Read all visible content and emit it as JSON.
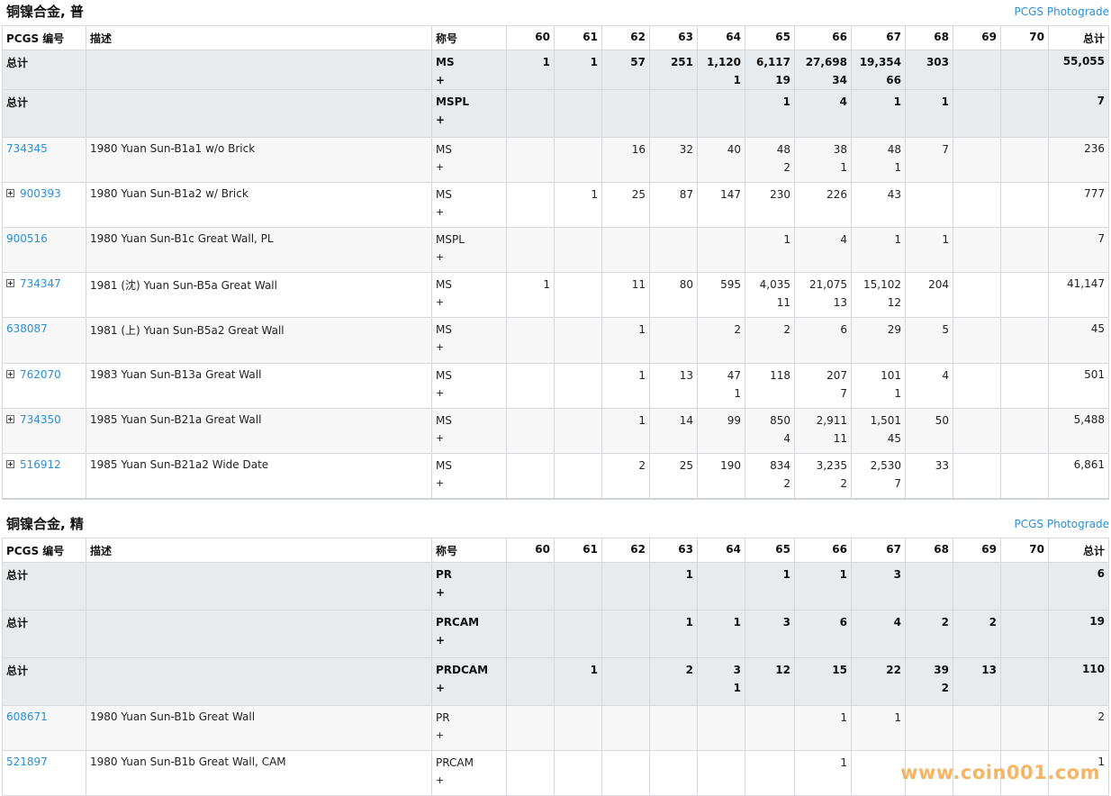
{
  "sections": [
    {
      "title": "铜镍合金, 普",
      "photograde": "PCGS Photograde",
      "headers": [
        "PCGS 编号",
        "描述",
        "称号",
        "60",
        "61",
        "62",
        "63",
        "64",
        "65",
        "66",
        "67",
        "68",
        "69",
        "70",
        "总计"
      ],
      "rows": [
        {
          "type": "total",
          "code": "总计",
          "desc": "",
          "desig": "MS",
          "plus": "+",
          "grades": [
            [
              "1",
              ""
            ],
            [
              "1",
              ""
            ],
            [
              "57",
              ""
            ],
            [
              "251",
              ""
            ],
            [
              "1,120",
              "1"
            ],
            [
              "6,117",
              "19"
            ],
            [
              "27,698",
              "34"
            ],
            [
              "19,354",
              "66"
            ],
            [
              "303",
              ""
            ],
            [
              "",
              ""
            ],
            [
              "",
              ""
            ]
          ],
          "total": "55,055"
        },
        {
          "type": "total",
          "code": "总计",
          "desc": "",
          "desig": "MSPL",
          "plus": "+",
          "grades": [
            [
              "",
              ""
            ],
            [
              "",
              ""
            ],
            [
              "",
              ""
            ],
            [
              "",
              ""
            ],
            [
              "",
              ""
            ],
            [
              "1",
              ""
            ],
            [
              "4",
              ""
            ],
            [
              "1",
              ""
            ],
            [
              "1",
              ""
            ],
            [
              "",
              ""
            ],
            [
              "",
              ""
            ]
          ],
          "total": "7"
        },
        {
          "type": "item",
          "code": "734345",
          "expand": false,
          "desc": "1980 Yuan Sun-B1a1 w/o Brick",
          "desig": "MS",
          "plus": "+",
          "grades": [
            [
              "",
              ""
            ],
            [
              "",
              ""
            ],
            [
              "16",
              ""
            ],
            [
              "32",
              ""
            ],
            [
              "40",
              ""
            ],
            [
              "48",
              "2"
            ],
            [
              "38",
              "1"
            ],
            [
              "48",
              "1"
            ],
            [
              "7",
              ""
            ],
            [
              "",
              ""
            ],
            [
              "",
              ""
            ]
          ],
          "total": "236"
        },
        {
          "type": "item",
          "code": "900393",
          "expand": true,
          "desc": "1980 Yuan Sun-B1a2 w/ Brick",
          "desig": "MS",
          "plus": "+",
          "grades": [
            [
              "",
              ""
            ],
            [
              "1",
              ""
            ],
            [
              "25",
              ""
            ],
            [
              "87",
              ""
            ],
            [
              "147",
              ""
            ],
            [
              "230",
              ""
            ],
            [
              "226",
              ""
            ],
            [
              "43",
              ""
            ],
            [
              "",
              ""
            ],
            [
              "",
              ""
            ],
            [
              "",
              ""
            ]
          ],
          "total": "777"
        },
        {
          "type": "item",
          "code": "900516",
          "expand": false,
          "desc": "1980 Yuan Sun-B1c Great Wall, PL",
          "desig": "MSPL",
          "plus": "+",
          "grades": [
            [
              "",
              ""
            ],
            [
              "",
              ""
            ],
            [
              "",
              ""
            ],
            [
              "",
              ""
            ],
            [
              "",
              ""
            ],
            [
              "1",
              ""
            ],
            [
              "4",
              ""
            ],
            [
              "1",
              ""
            ],
            [
              "1",
              ""
            ],
            [
              "",
              ""
            ],
            [
              "",
              ""
            ]
          ],
          "total": "7"
        },
        {
          "type": "item",
          "code": "734347",
          "expand": true,
          "desc": "1981 (沈) Yuan Sun-B5a Great Wall",
          "desig": "MS",
          "plus": "+",
          "grades": [
            [
              "1",
              ""
            ],
            [
              "",
              ""
            ],
            [
              "11",
              ""
            ],
            [
              "80",
              ""
            ],
            [
              "595",
              ""
            ],
            [
              "4,035",
              "11"
            ],
            [
              "21,075",
              "13"
            ],
            [
              "15,102",
              "12"
            ],
            [
              "204",
              ""
            ],
            [
              "",
              ""
            ],
            [
              "",
              ""
            ]
          ],
          "total": "41,147"
        },
        {
          "type": "item",
          "code": "638087",
          "expand": false,
          "desc": "1981 (上) Yuan Sun-B5a2 Great Wall",
          "desig": "MS",
          "plus": "+",
          "grades": [
            [
              "",
              ""
            ],
            [
              "",
              ""
            ],
            [
              "1",
              ""
            ],
            [
              "",
              ""
            ],
            [
              "2",
              ""
            ],
            [
              "2",
              ""
            ],
            [
              "6",
              ""
            ],
            [
              "29",
              ""
            ],
            [
              "5",
              ""
            ],
            [
              "",
              ""
            ],
            [
              "",
              ""
            ]
          ],
          "total": "45"
        },
        {
          "type": "item",
          "code": "762070",
          "expand": true,
          "desc": "1983 Yuan Sun-B13a Great Wall",
          "desig": "MS",
          "plus": "+",
          "grades": [
            [
              "",
              ""
            ],
            [
              "",
              ""
            ],
            [
              "1",
              ""
            ],
            [
              "13",
              ""
            ],
            [
              "47",
              "1"
            ],
            [
              "118",
              ""
            ],
            [
              "207",
              "7"
            ],
            [
              "101",
              "1"
            ],
            [
              "4",
              ""
            ],
            [
              "",
              ""
            ],
            [
              "",
              ""
            ]
          ],
          "total": "501"
        },
        {
          "type": "item",
          "code": "734350",
          "expand": true,
          "desc": "1985 Yuan Sun-B21a Great Wall",
          "desig": "MS",
          "plus": "+",
          "grades": [
            [
              "",
              ""
            ],
            [
              "",
              ""
            ],
            [
              "1",
              ""
            ],
            [
              "14",
              ""
            ],
            [
              "99",
              ""
            ],
            [
              "850",
              "4"
            ],
            [
              "2,911",
              "11"
            ],
            [
              "1,501",
              "45"
            ],
            [
              "50",
              ""
            ],
            [
              "",
              ""
            ],
            [
              "",
              ""
            ]
          ],
          "total": "5,488"
        },
        {
          "type": "item",
          "code": "516912",
          "expand": true,
          "desc": "1985 Yuan Sun-B21a2 Wide Date",
          "desig": "MS",
          "plus": "+",
          "grades": [
            [
              "",
              ""
            ],
            [
              "",
              ""
            ],
            [
              "2",
              ""
            ],
            [
              "25",
              ""
            ],
            [
              "190",
              ""
            ],
            [
              "834",
              "2"
            ],
            [
              "3,235",
              "2"
            ],
            [
              "2,530",
              "7"
            ],
            [
              "33",
              ""
            ],
            [
              "",
              ""
            ],
            [
              "",
              ""
            ]
          ],
          "total": "6,861"
        }
      ]
    },
    {
      "title": "铜镍合金, 精",
      "photograde": "PCGS Photograde",
      "headers": [
        "PCGS 编号",
        "描述",
        "称号",
        "60",
        "61",
        "62",
        "63",
        "64",
        "65",
        "66",
        "67",
        "68",
        "69",
        "70",
        "总计"
      ],
      "rows": [
        {
          "type": "total",
          "code": "总计",
          "desc": "",
          "desig": "PR",
          "plus": "+",
          "grades": [
            [
              "",
              ""
            ],
            [
              "",
              ""
            ],
            [
              "",
              ""
            ],
            [
              "1",
              ""
            ],
            [
              "",
              ""
            ],
            [
              "1",
              ""
            ],
            [
              "1",
              ""
            ],
            [
              "3",
              ""
            ],
            [
              "",
              ""
            ],
            [
              "",
              ""
            ],
            [
              "",
              ""
            ]
          ],
          "total": "6"
        },
        {
          "type": "total",
          "code": "总计",
          "desc": "",
          "desig": "PRCAM",
          "plus": "+",
          "grades": [
            [
              "",
              ""
            ],
            [
              "",
              ""
            ],
            [
              "",
              ""
            ],
            [
              "1",
              ""
            ],
            [
              "1",
              ""
            ],
            [
              "3",
              ""
            ],
            [
              "6",
              ""
            ],
            [
              "4",
              ""
            ],
            [
              "2",
              ""
            ],
            [
              "2",
              ""
            ],
            [
              "",
              ""
            ]
          ],
          "total": "19"
        },
        {
          "type": "total",
          "code": "总计",
          "desc": "",
          "desig": "PRDCAM",
          "plus": "+",
          "grades": [
            [
              "",
              ""
            ],
            [
              "1",
              ""
            ],
            [
              "",
              ""
            ],
            [
              "2",
              ""
            ],
            [
              "3",
              "1"
            ],
            [
              "12",
              ""
            ],
            [
              "15",
              ""
            ],
            [
              "22",
              ""
            ],
            [
              "39",
              "2"
            ],
            [
              "13",
              ""
            ],
            [
              "",
              ""
            ]
          ],
          "total": "110"
        },
        {
          "type": "item",
          "code": "608671",
          "expand": false,
          "desc": "1980 Yuan Sun-B1b Great Wall",
          "desig": "PR",
          "plus": "+",
          "grades": [
            [
              "",
              ""
            ],
            [
              "",
              ""
            ],
            [
              "",
              ""
            ],
            [
              "",
              ""
            ],
            [
              "",
              ""
            ],
            [
              "",
              ""
            ],
            [
              "1",
              ""
            ],
            [
              "1",
              ""
            ],
            [
              "",
              ""
            ],
            [
              "",
              ""
            ],
            [
              "",
              ""
            ]
          ],
          "total": "2"
        },
        {
          "type": "item",
          "code": "521897",
          "expand": false,
          "desc": "1980 Yuan Sun-B1b Great Wall, CAM",
          "desig": "PRCAM",
          "plus": "+",
          "grades": [
            [
              "",
              ""
            ],
            [
              "",
              ""
            ],
            [
              "",
              ""
            ],
            [
              "",
              ""
            ],
            [
              "",
              ""
            ],
            [
              "",
              ""
            ],
            [
              "1",
              ""
            ],
            [
              "",
              ""
            ],
            [
              "",
              ""
            ],
            [
              "",
              ""
            ],
            [
              "",
              ""
            ]
          ],
          "total": "1"
        }
      ]
    }
  ],
  "watermark": "www.coin001.com"
}
